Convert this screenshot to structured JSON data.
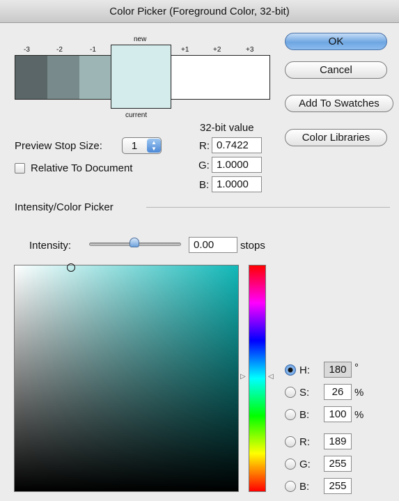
{
  "window": {
    "title": "Color Picker (Foreground Color, 32-bit)"
  },
  "colors": {
    "stop_minus3": "#5a6667",
    "stop_minus2": "#788a8b",
    "stop_minus1": "#9db6b5",
    "new": "#d4ecec",
    "stops_plus": "#ffffff",
    "accent": "#4b88d6"
  },
  "preview": {
    "labels": [
      "-3",
      "-2",
      "-1",
      "+1",
      "+2",
      "+3"
    ],
    "new_label": "new",
    "current_label": "current"
  },
  "buttons": {
    "ok": "OK",
    "cancel": "Cancel",
    "add_to_swatches": "Add To Swatches",
    "color_libraries": "Color Libraries"
  },
  "preview_stop": {
    "label": "Preview Stop Size:",
    "value": "1"
  },
  "relative": {
    "label": "Relative To Document",
    "checked": false
  },
  "bit32": {
    "title": "32-bit value",
    "r_label": "R:",
    "r": "0.7422",
    "g_label": "G:",
    "g": "1.0000",
    "b_label": "B:",
    "b": "1.0000"
  },
  "intensity_section": {
    "title": "Intensity/Color Picker"
  },
  "intensity": {
    "label": "Intensity:",
    "value": "0.00",
    "unit": "stops"
  },
  "hsb_rgb": {
    "selected": "H",
    "h_label": "H:",
    "h": "180",
    "h_unit": "°",
    "s_label": "S:",
    "s": "26",
    "s_unit": "%",
    "b_label": "B:",
    "b": "100",
    "b_unit": "%",
    "r_label": "R:",
    "r": "189",
    "g_label": "G:",
    "g": "255",
    "bb_label": "B:",
    "bb": "255"
  },
  "icons": [
    "stepper-arrows-icon",
    "hue-slider-left-arrow-icon",
    "hue-slider-right-arrow-icon",
    "field-marker-icon"
  ]
}
